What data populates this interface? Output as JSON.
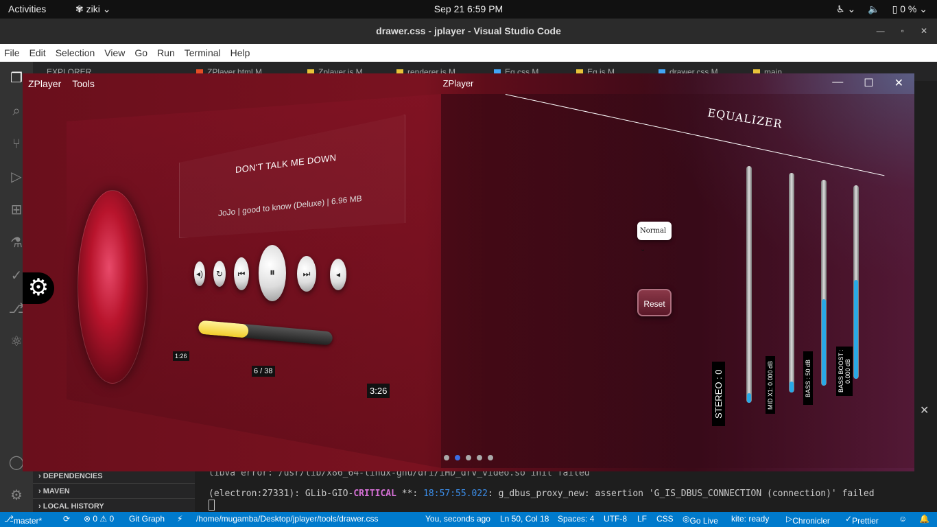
{
  "gnome": {
    "activities": "Activities",
    "app": "ziki",
    "clock": "Sep 21   6:59 PM",
    "battery": "0 %"
  },
  "vscode": {
    "title": "drawer.css - jplayer - Visual Studio Code",
    "menu": [
      "File",
      "Edit",
      "Selection",
      "View",
      "Go",
      "Run",
      "Terminal",
      "Help"
    ],
    "explorer_label": "EXPLORER",
    "tabs": [
      {
        "label": "ZPlayer.html M",
        "color": "#e44d26"
      },
      {
        "label": "Zplayer.js M",
        "color": "#e8c33a"
      },
      {
        "label": "renderer.js M",
        "color": "#e8c33a"
      },
      {
        "label": "Eq.css M",
        "color": "#42a5f5"
      },
      {
        "label": "Eq.js M",
        "color": "#e8c33a"
      },
      {
        "label": "drawer.css M",
        "color": "#42a5f5"
      },
      {
        "label": "main",
        "color": "#e8c33a"
      }
    ],
    "sidebar_sections": [
      "DEPENDENCIES",
      "MAVEN",
      "LOCAL HISTORY"
    ],
    "terminal": {
      "line1": "libva error: /usr/lib/x86_64-linux-gnu/dri/iHD_drv_video.so init failed",
      "line2_prefix": "(electron:27331): GLib-GIO-",
      "line2_critical": "CRITICAL",
      "line2_mid": " **: ",
      "line2_time": "18:57:55.022",
      "line2_suffix": ": g_dbus_proxy_new: assertion 'G_IS_DBUS_CONNECTION (connection)' failed"
    },
    "status": {
      "branch": "master*",
      "problems": "⊗ 0 ⚠ 0",
      "git_graph": "Git Graph",
      "path": "/home/mugamba/Desktop/jplayer/tools/drawer.css",
      "blame": "You, seconds ago",
      "position": "Ln 50, Col 18",
      "spaces": "Spaces: 4",
      "encoding": "UTF-8",
      "eol": "LF",
      "language": "CSS",
      "golive": "Go Live",
      "kite": "kite: ready",
      "chronicler": "Chronicler",
      "prettier": "Prettier"
    }
  },
  "zplayer": {
    "menu": [
      "ZPlayer",
      "Tools"
    ],
    "title": "ZPlayer",
    "song_title": "DON'T TALK ME DOWN",
    "song_meta": "JoJo  |  good to know (Deluxe)  |  6.96 MB",
    "progress_fraction": 0.37,
    "time_elapsed": "1:26",
    "track_counter": "6 / 38",
    "time_total": "3:26",
    "equalizer_title": "EQUALIZER",
    "preset": "Normal",
    "reset_label": "Reset",
    "eq_labels": [
      "STEREO : 0",
      "MID X1: 0.000 dB",
      "BASS : 50 dB",
      "BASS BOOST : 0.000 dB"
    ],
    "eq_levels": [
      0.04,
      0.05,
      0.42,
      0.51
    ],
    "carousel_dots": 5,
    "carousel_active": 1
  }
}
